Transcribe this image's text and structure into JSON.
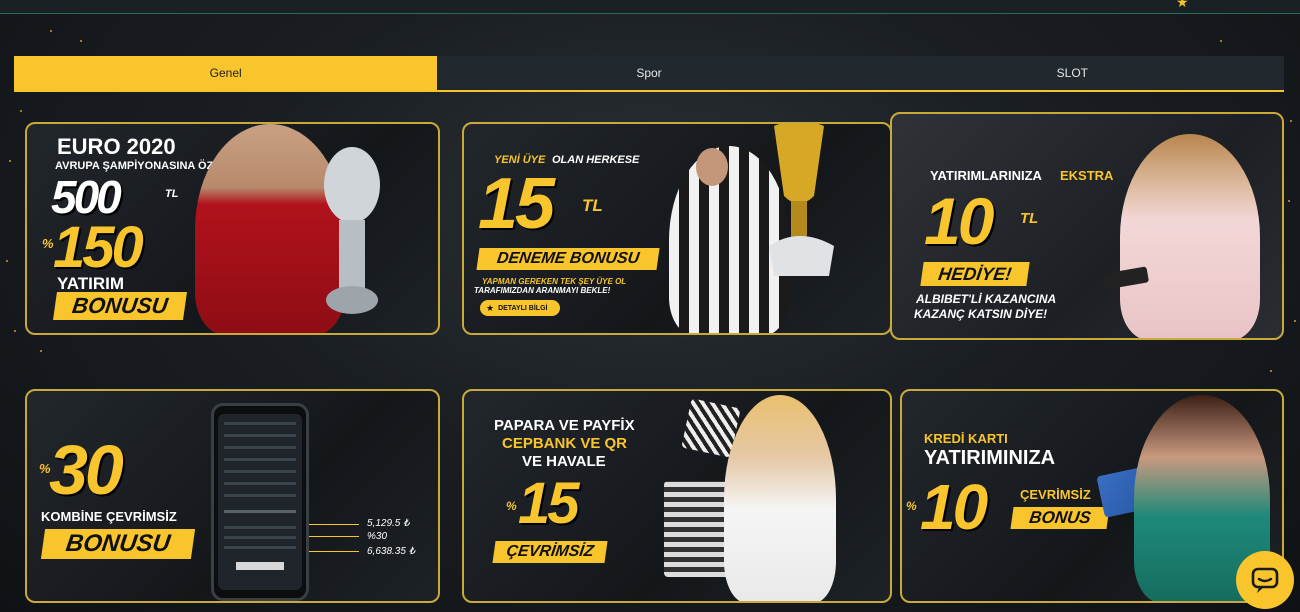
{
  "tabs": [
    {
      "label": "Genel",
      "active": true
    },
    {
      "label": "Spor",
      "active": false
    },
    {
      "label": "SLOT",
      "active": false
    }
  ],
  "promos": {
    "euro": {
      "title": "EURO 2020",
      "subtitle": "AVRUPA ŞAMPİYONASINA ÖZEL",
      "amount": "500",
      "currency": "TL",
      "percent_sign": "%",
      "percent": "150",
      "line1": "YATIRIM",
      "badge": "BONUSU"
    },
    "deneme": {
      "headline_yellow": "YENİ ÜYE",
      "headline_white": "OLAN HERKESE",
      "amount": "15",
      "currency": "TL",
      "badge": "DENEME BONUSU",
      "note1": "YAPMAN GEREKEN TEK ŞEY ÜYE OL",
      "note2": "TARAFIMIZDAN ARANMAYI BEKLE!",
      "button": "DETAYLI BİLGİ"
    },
    "ekstra": {
      "headline_white": "YATIRIMLARINIZA",
      "headline_yellow": "EKSTRA",
      "amount": "10",
      "currency": "TL",
      "badge": "HEDİYE!",
      "line1": "ALBIBET'Lİ KAZANCINA",
      "line2": "KAZANÇ KATSIN DİYE!"
    },
    "kombine": {
      "percent_sign": "%",
      "amount": "30",
      "line1": "KOMBİNE ÇEVRİMSİZ",
      "badge": "BONUSU",
      "val1": "5,129.5 ₺",
      "val2": "%30",
      "val3": "6,638.35 ₺"
    },
    "papara": {
      "line1": "PAPARA VE PAYFİX",
      "line2": "CEPBANK VE QR",
      "line3": "VE HAVALE",
      "percent_sign": "%",
      "amount": "15",
      "badge": "ÇEVRİMSİZ"
    },
    "kredi": {
      "line1": "KREDİ KARTI",
      "line2": "YATIRIMINIZA",
      "percent_sign": "%",
      "amount": "10",
      "line3": "ÇEVRİMSİZ",
      "badge": "BONUS"
    }
  },
  "colors": {
    "accent": "#f9c52d",
    "tab_bg": "#22292e",
    "border": "#c9a93a"
  },
  "icons": {
    "chat": "chat-bubble-icon",
    "star": "star-icon"
  }
}
